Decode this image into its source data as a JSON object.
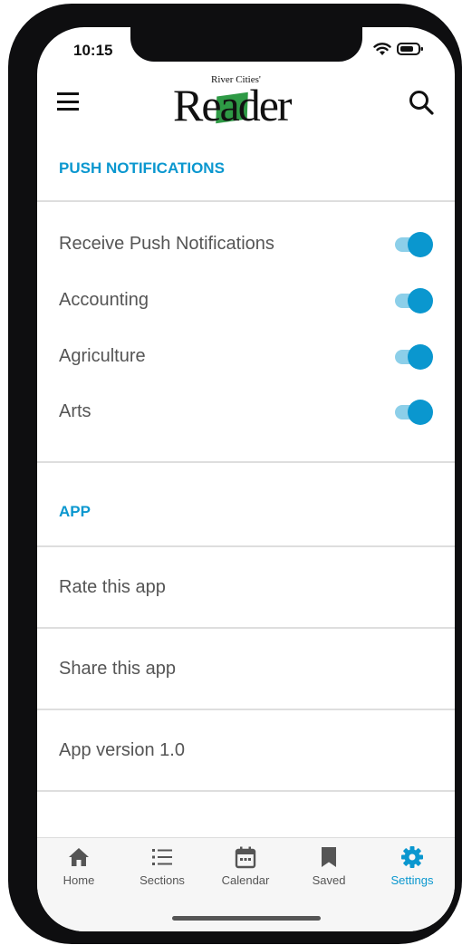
{
  "status_bar": {
    "time": "10:15",
    "wifi_icon": "wifi-icon",
    "battery_icon": "battery-icon"
  },
  "header": {
    "menu_icon": "hamburger-menu-icon",
    "logo_small_text": "River Cities'",
    "logo_main_text": "Reader",
    "search_icon": "search-icon"
  },
  "push_notifications": {
    "title": "PUSH NOTIFICATIONS",
    "items": [
      {
        "label": "Receive Push Notifications",
        "enabled": true
      },
      {
        "label": "Accounting",
        "enabled": true
      },
      {
        "label": "Agriculture",
        "enabled": true
      },
      {
        "label": "Arts",
        "enabled": true
      }
    ]
  },
  "app_section": {
    "title": "APP",
    "items": [
      {
        "label": "Rate this app"
      },
      {
        "label": "Share this app"
      },
      {
        "label": "App version 1.0"
      }
    ]
  },
  "tab_bar": {
    "active": "Settings",
    "tabs": [
      {
        "label": "Home",
        "icon": "home-icon"
      },
      {
        "label": "Sections",
        "icon": "list-icon"
      },
      {
        "label": "Calendar",
        "icon": "calendar-icon"
      },
      {
        "label": "Saved",
        "icon": "bookmark-icon"
      },
      {
        "label": "Settings",
        "icon": "gear-icon"
      }
    ]
  },
  "colors": {
    "accent": "#0a97cf",
    "toggle_track": "#8ccfe9",
    "logo_green": "#2e9a45"
  }
}
